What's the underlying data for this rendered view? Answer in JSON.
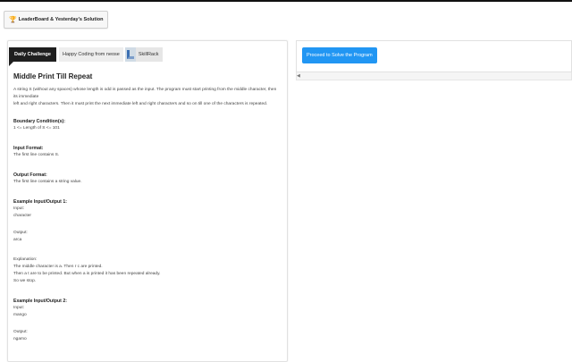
{
  "toolbar": {
    "leaderboard_label": "LeaderBoard & Yesterday's Solution"
  },
  "tabs": {
    "daily": "Daily Challenge",
    "happy": "Happy Coding from neose",
    "skill": "SkillRack"
  },
  "problem": {
    "title": "Middle Print Till Repeat",
    "desc_lines": [
      "A string S (without any spaces) whose length is odd is passed as the input. The program must start printing from the middle character, then its immediate",
      "left and right characters. Then it must print the next immediate left and right characters and so on till one of the characters is repeated."
    ],
    "boundary_heading": "Boundary Condition(s):",
    "boundary_text": "1 <= Length of S <= 101",
    "input_heading": "Input Format:",
    "input_text": "The first line contains S.",
    "output_heading": "Output Format:",
    "output_text": "The first line contains a string value.",
    "ex1_heading": "Example Input/Output 1:",
    "ex1_input_label": "Input:",
    "ex1_input": "character",
    "ex1_output_label": "Output:",
    "ex1_output": "arca",
    "explanation_label": "Explanation:",
    "explanation_lines": [
      "The middle character is a. Then r c are printed.",
      "Then a t are to be printed. But when a is printed it has been repeated already.",
      "So we stop."
    ],
    "ex2_heading": "Example Input/Output 2:",
    "ex2_input_label": "Input:",
    "ex2_input": "mango",
    "ex2_output_label": "Output:",
    "ex2_output": "ngamo"
  },
  "editor": {
    "proceed_label": "Proceed to Solve the Program"
  },
  "icons": {
    "leaderboard": "trophy-icon",
    "skillrack": "skillrack-logo-icon",
    "scroll": "arrow-left-icon"
  },
  "colors": {
    "accent": "#2196f3",
    "tab_dark": "#1f1f1f"
  }
}
